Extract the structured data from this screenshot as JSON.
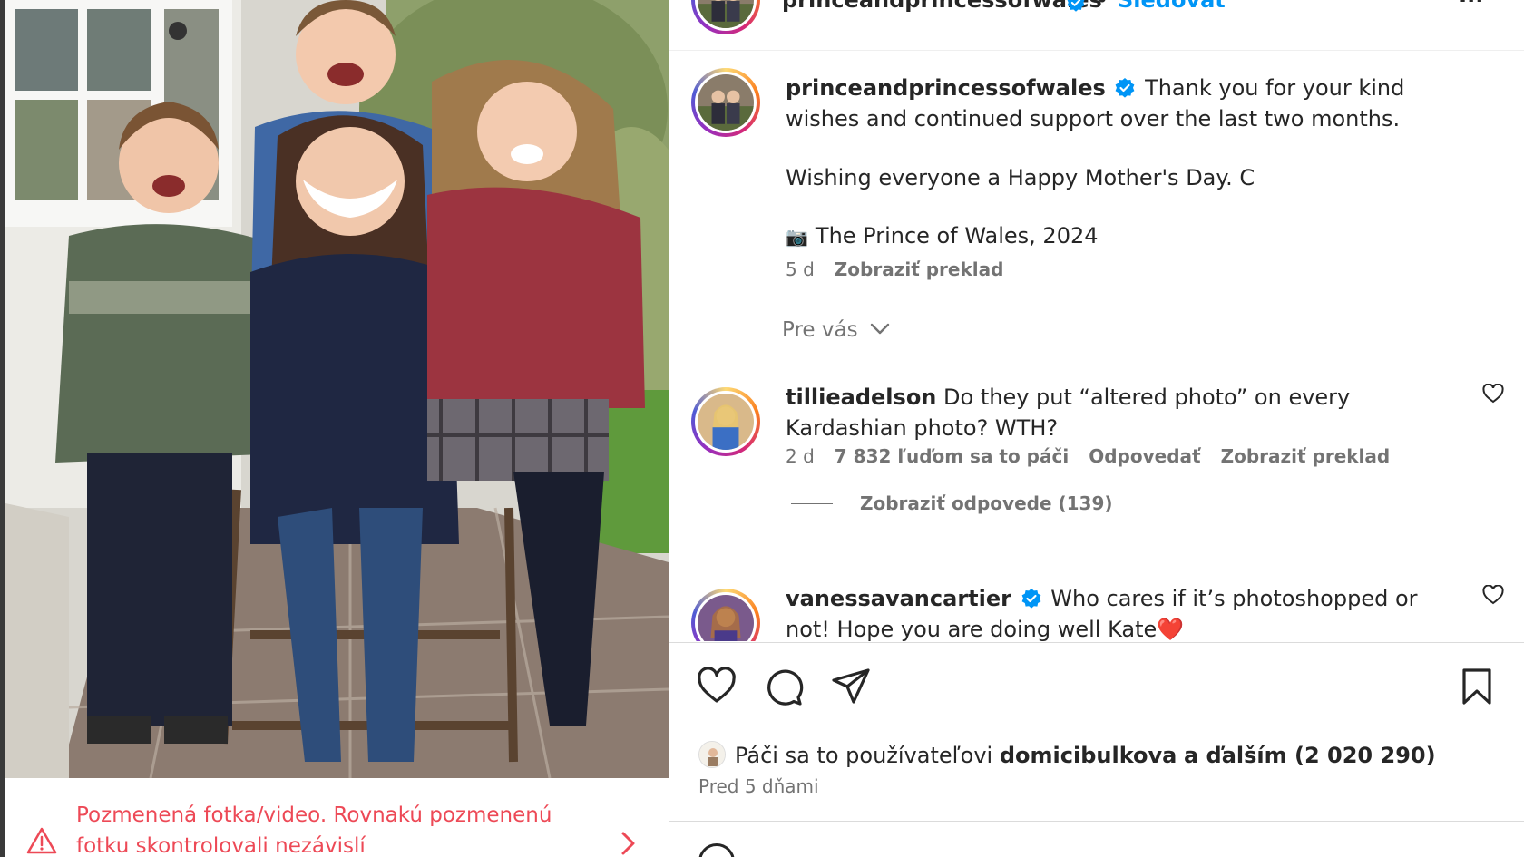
{
  "header": {
    "username": "princeandprincessofwales",
    "separator": "•",
    "follow_label": "Sledovať",
    "more_label": "···"
  },
  "caption": {
    "username": "princeandprincessofwales",
    "text_line1": "Thank you for your kind wishes and continued support over the last two months.",
    "text_line2": "Wishing everyone a Happy Mother's Day. C",
    "camera_emoji": "📷",
    "credit": "The Prince of Wales, 2024",
    "age": "5 d",
    "translate_label": "Zobraziť preklad"
  },
  "filter": {
    "label": "Pre vás"
  },
  "comments": [
    {
      "username": "tillieadelson",
      "text": "Do they put “altered photo” on every Kardashian photo? WTH?",
      "age": "2 d",
      "likes": "7 832 ľuďom sa to páči",
      "reply_label": "Odpovedať",
      "translate_label": "Zobraziť preklad",
      "view_replies_label": "Zobraziť odpovede (139)"
    },
    {
      "username": "vanessavancartier",
      "text": "Who cares if it’s photoshopped or not! Hope you are doing well Kate❤️"
    }
  ],
  "likes_bar": {
    "prefix": "Páči sa to používateľovi",
    "liker": "domicibulkova",
    "suffix": "a ďalším (2 020 290)"
  },
  "posted_time": "Pred 5 dňami",
  "warning": {
    "text": "Pozmenená fotka/video. Rovnakú pozmenenú fotku skontrolovali nezávislí"
  },
  "colors": {
    "accent_blue": "#0095f6",
    "warning_red": "#ed4956",
    "verified_blue": "#0095f6",
    "muted_text": "#737373"
  },
  "icons": [
    "heart-icon",
    "comment-icon",
    "share-icon",
    "bookmark-icon",
    "verified-badge-icon",
    "chevron-down-icon",
    "warning-triangle-icon",
    "chevron-right-icon",
    "small-heart-icon"
  ]
}
